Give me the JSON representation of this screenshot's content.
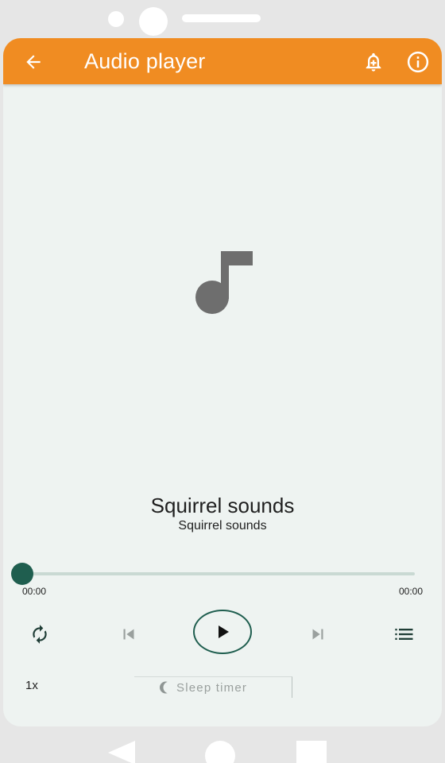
{
  "colors": {
    "accent": "#f08c22",
    "primary": "#1f5e4f",
    "background": "#eef3f1",
    "device": "#e6e6e6"
  },
  "appbar": {
    "title": "Audio player",
    "back_icon": "arrow-back-icon",
    "alarm_icon": "alarm-add-icon",
    "info_icon": "info-icon"
  },
  "artwork": {
    "icon": "music-note-icon"
  },
  "track": {
    "title": "Squirrel sounds",
    "subtitle": "Squirrel sounds"
  },
  "progress": {
    "position_fraction": 0.0,
    "elapsed": "00:00",
    "duration": "00:00"
  },
  "controls": {
    "repeat_icon": "repeat-icon",
    "previous_icon": "skip-previous-icon",
    "play_icon": "play-icon",
    "next_icon": "skip-next-icon",
    "queue_icon": "queue-list-icon"
  },
  "bottom": {
    "speed_label": "1x",
    "sleep_label": "Sleep timer",
    "sleep_icon": "moon-icon"
  },
  "system_nav": {
    "back_icon": "nav-back-triangle-icon",
    "home_icon": "nav-home-circle-icon",
    "recents_icon": "nav-recents-square-icon"
  }
}
